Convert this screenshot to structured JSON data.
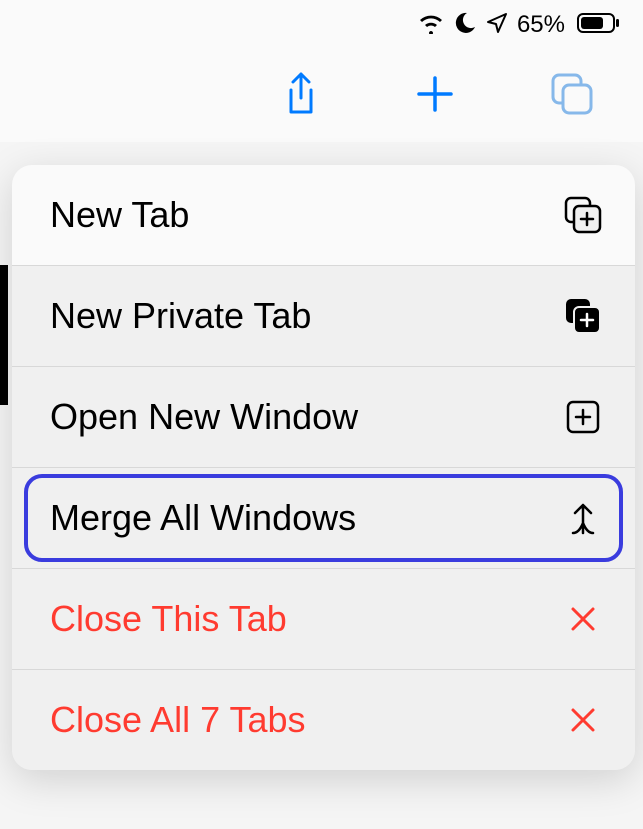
{
  "status": {
    "battery_text": "65%"
  },
  "toolbar": {
    "share_icon": "share",
    "add_icon": "plus",
    "tabs_icon": "tabs"
  },
  "menu": {
    "items": [
      {
        "label": "New Tab",
        "icon": "new-tab",
        "destructive": false,
        "highlighted": false
      },
      {
        "label": "New Private Tab",
        "icon": "new-private-tab",
        "destructive": false,
        "highlighted": false
      },
      {
        "label": "Open New Window",
        "icon": "plus-square",
        "destructive": false,
        "highlighted": false
      },
      {
        "label": "Merge All Windows",
        "icon": "merge",
        "destructive": false,
        "highlighted": true
      },
      {
        "label": "Close This Tab",
        "icon": "close",
        "destructive": true,
        "highlighted": false
      },
      {
        "label": "Close All 7 Tabs",
        "icon": "close",
        "destructive": true,
        "highlighted": false
      }
    ]
  }
}
